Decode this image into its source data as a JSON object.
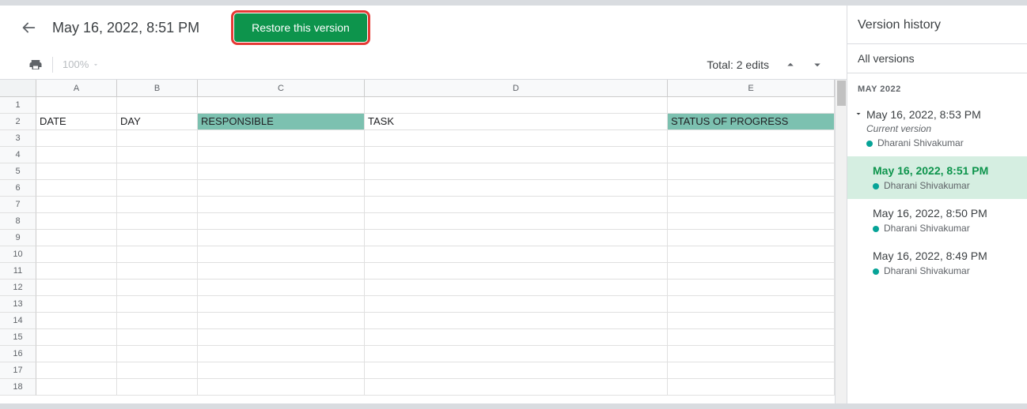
{
  "header": {
    "title": "May 16, 2022, 8:51 PM",
    "restore_label": "Restore this version"
  },
  "toolbar": {
    "zoom": "100%",
    "edit_count": "Total: 2 edits"
  },
  "sheet": {
    "columns": [
      "A",
      "B",
      "C",
      "D",
      "E"
    ],
    "row_count": 18,
    "header_row": {
      "index": 2,
      "cells": [
        {
          "value": "DATE",
          "hl": false
        },
        {
          "value": "DAY",
          "hl": false
        },
        {
          "value": "RESPONSIBLE",
          "hl": true
        },
        {
          "value": "TASK",
          "hl": false
        },
        {
          "value": "STATUS OF PROGRESS",
          "hl": true
        }
      ]
    }
  },
  "sidebar": {
    "title": "Version history",
    "filter_label": "All versions",
    "group_label": "MAY 2022",
    "current_label": "Current version",
    "versions": [
      {
        "date": "May 16, 2022, 8:53 PM",
        "author": "Dharani Shivakumar",
        "current": true,
        "selected": false,
        "dot": "#06a397"
      },
      {
        "date": "May 16, 2022, 8:51 PM",
        "author": "Dharani Shivakumar",
        "current": false,
        "selected": true,
        "dot": "#06a397"
      },
      {
        "date": "May 16, 2022, 8:50 PM",
        "author": "Dharani Shivakumar",
        "current": false,
        "selected": false,
        "dot": "#06a397"
      },
      {
        "date": "May 16, 2022, 8:49 PM",
        "author": "Dharani Shivakumar",
        "current": false,
        "selected": false,
        "dot": "#06a397"
      }
    ]
  }
}
